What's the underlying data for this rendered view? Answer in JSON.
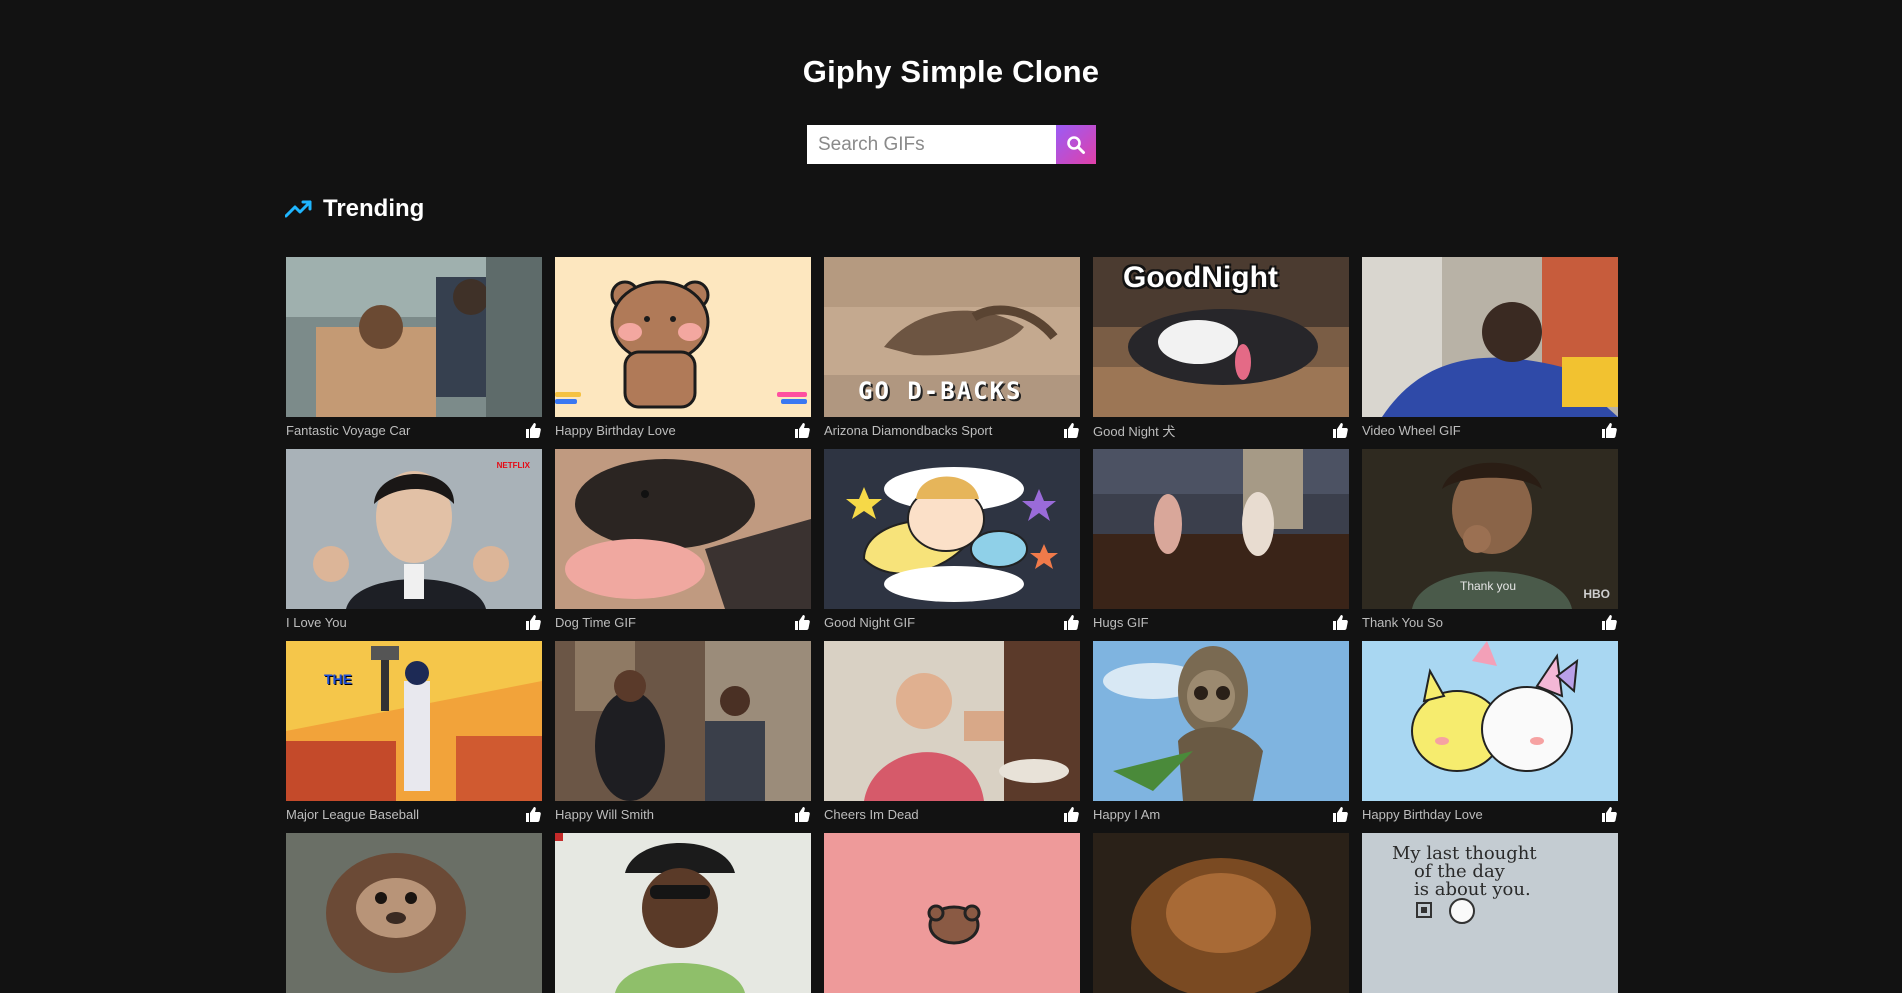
{
  "app": {
    "title": "Giphy Simple Clone"
  },
  "search": {
    "placeholder": "Search GIFs",
    "button_icon": "search-icon"
  },
  "section": {
    "title": "Trending",
    "icon": "trending-up-icon",
    "accent": "#1fb6ff"
  },
  "theme": {
    "background": "#121212",
    "search_button_gradient": [
      "#9b5cf6",
      "#e040a8"
    ]
  },
  "gifs": [
    {
      "title": "Fantastic Voyage Car"
    },
    {
      "title": "Happy Birthday Love"
    },
    {
      "title": "Arizona Diamondbacks Sport",
      "overlay": "GO D-BACKS"
    },
    {
      "title": "Good Night 犬",
      "overlay": "GoodNight"
    },
    {
      "title": "Video Wheel GIF"
    },
    {
      "title": "I Love You",
      "overlay": "NETFLIX"
    },
    {
      "title": "Dog Time GIF"
    },
    {
      "title": "Good Night GIF"
    },
    {
      "title": "Hugs GIF"
    },
    {
      "title": "Thank You So",
      "overlay": "Thank you",
      "overlay2": "HBO"
    },
    {
      "title": "Major League Baseball",
      "overlay": "THE"
    },
    {
      "title": "Happy Will Smith"
    },
    {
      "title": "Cheers Im Dead"
    },
    {
      "title": "Happy I Am"
    },
    {
      "title": "Happy Birthday Love"
    },
    {
      "title": ""
    },
    {
      "title": ""
    },
    {
      "title": ""
    },
    {
      "title": ""
    },
    {
      "title": "",
      "overlay": "My last thought",
      "overlay2": "of the day",
      "overlay3": "is about you."
    }
  ]
}
